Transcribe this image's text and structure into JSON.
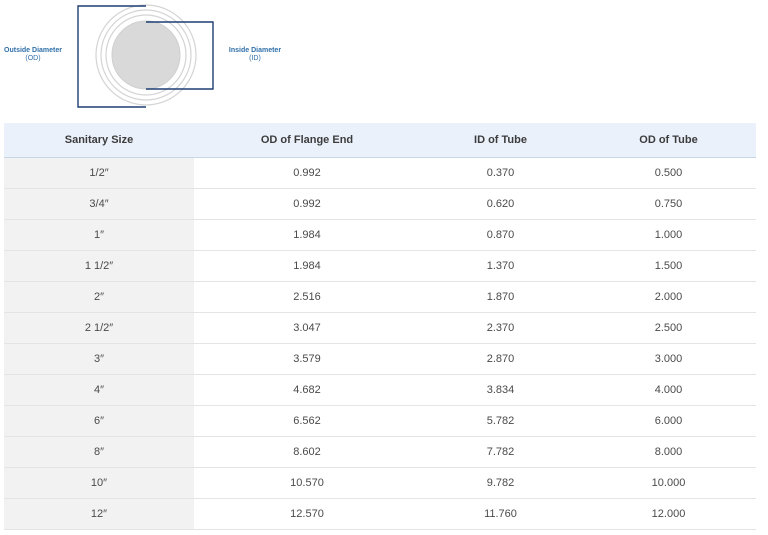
{
  "diagram": {
    "od_label": "Outside Diameter",
    "od_abbr": "(OD)",
    "id_label": "Inside Diameter",
    "id_abbr": "(ID)",
    "colors": {
      "frame": "#1e3f73",
      "label": "#2f6fa8",
      "ring": "#c8c8c8",
      "fill": "#d9d9d9"
    }
  },
  "table": {
    "headers": [
      "Sanitary Size",
      "OD of Flange End",
      "ID of Tube",
      "OD of Tube"
    ],
    "rows": [
      [
        "1/2″",
        "0.992",
        "0.370",
        "0.500"
      ],
      [
        "3/4″",
        "0.992",
        "0.620",
        "0.750"
      ],
      [
        "1″",
        "1.984",
        "0.870",
        "1.000"
      ],
      [
        "1 1/2″",
        "1.984",
        "1.370",
        "1.500"
      ],
      [
        "2″",
        "2.516",
        "1.870",
        "2.000"
      ],
      [
        "2 1/2″",
        "3.047",
        "2.370",
        "2.500"
      ],
      [
        "3″",
        "3.579",
        "2.870",
        "3.000"
      ],
      [
        "4″",
        "4.682",
        "3.834",
        "4.000"
      ],
      [
        "6″",
        "6.562",
        "5.782",
        "6.000"
      ],
      [
        "8″",
        "8.602",
        "7.782",
        "8.000"
      ],
      [
        "10″",
        "10.570",
        "9.782",
        "10.000"
      ],
      [
        "12″",
        "12.570",
        "11.760",
        "12.000"
      ]
    ],
    "colors": {
      "header_bg": "#eaf1fb",
      "first_col_bg": "#f2f2f2"
    }
  }
}
